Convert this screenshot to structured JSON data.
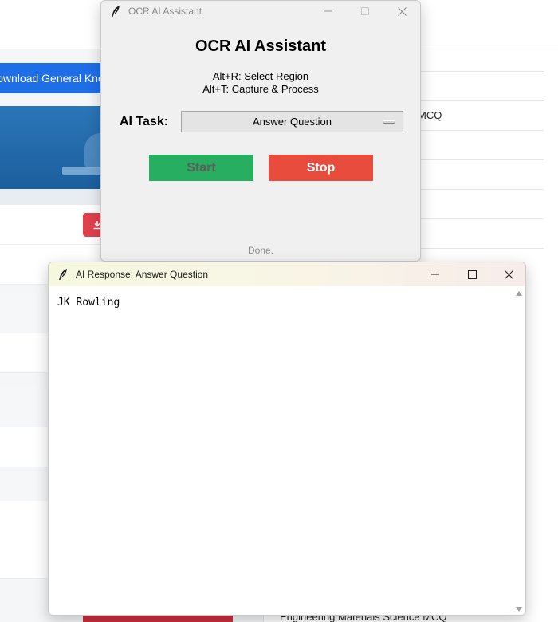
{
  "background_page": {
    "download_button_label": "Download General Knowledge",
    "list_items": [
      "MCQ",
      "Engineering Materials Science MCQ"
    ]
  },
  "ocr_window": {
    "titlebar_title": "OCR AI Assistant",
    "heading": "OCR AI Assistant",
    "hotkeys": [
      "Alt+R: Select Region",
      "Alt+T: Capture & Process"
    ],
    "task_label": "AI Task:",
    "task_selected": "Answer Question",
    "start_label": "Start",
    "stop_label": "Stop",
    "status": "Done.",
    "colors": {
      "start": "#27ae60",
      "stop": "#e74c3c"
    }
  },
  "response_window": {
    "titlebar_title": "AI Response: Answer Question",
    "response_text": "JK Rowling"
  }
}
